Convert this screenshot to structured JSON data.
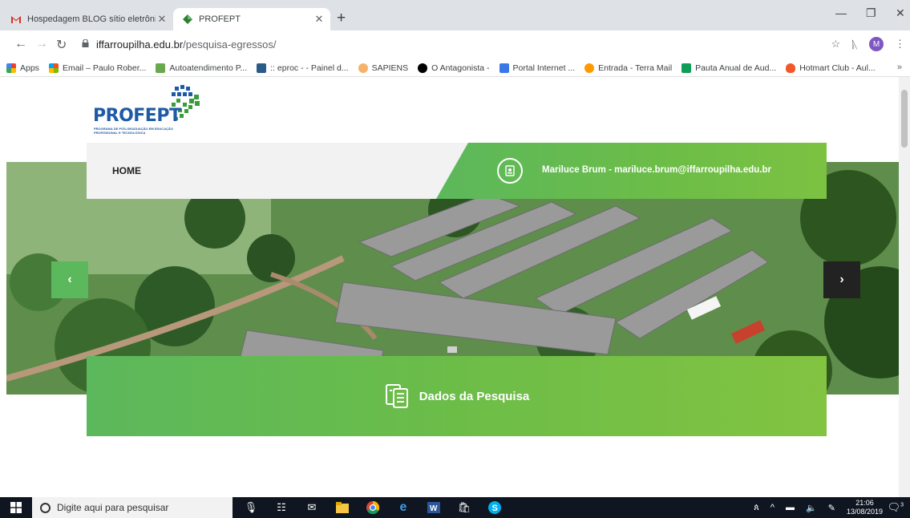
{
  "browser": {
    "tabs": [
      {
        "title": "Hospedagem BLOG sítio eletrôni",
        "icon": "gmail-icon",
        "active": false
      },
      {
        "title": "PROFEPT",
        "icon": "profept-favicon-icon",
        "active": true
      }
    ],
    "url_host": "iffarroupilha.edu.br",
    "url_path": "/pesquisa-egressos/",
    "profile_initial": "M",
    "bookmarks": [
      {
        "label": "Apps",
        "color": "#e8453c"
      },
      {
        "label": "Email – Paulo Rober...",
        "color": "#f4b400"
      },
      {
        "label": "Autoatendimento P...",
        "color": "#6aa84f"
      },
      {
        "label": ":: eproc - - Painel d...",
        "color": "#2c5b8a"
      },
      {
        "label": "SAPIENS",
        "color": "#f6b26b"
      },
      {
        "label": "O Antagonista -",
        "color": "#000000"
      },
      {
        "label": "Portal Internet ...",
        "color": "#3b78e7"
      },
      {
        "label": "Entrada - Terra Mail",
        "color": "#ff9900"
      },
      {
        "label": "Pauta Anual de Aud...",
        "color": "#0f9d58"
      },
      {
        "label": "Hotmart Club - Aul...",
        "color": "#f1592a"
      }
    ],
    "more_bookmarks": "»"
  },
  "site": {
    "logo_text": "PROFEPT",
    "logo_subtitle": "PROGRAMA DE PÓS-GRADUAÇÃO EM EDUCAÇÃO PROFISSIONAL E TECNOLÓGICA",
    "nav_home": "HOME",
    "contact": "Mariluce Brum - mariluce.brum@iffarroupilha.edu.br",
    "carousel_prev": "‹",
    "carousel_next": "›",
    "section_title": "Dados da Pesquisa",
    "accent_green": "#6dbd47"
  },
  "taskbar": {
    "search_placeholder": "Digite aqui para pesquisar",
    "time": "21:06",
    "date": "13/08/2019",
    "notifications": "3"
  }
}
